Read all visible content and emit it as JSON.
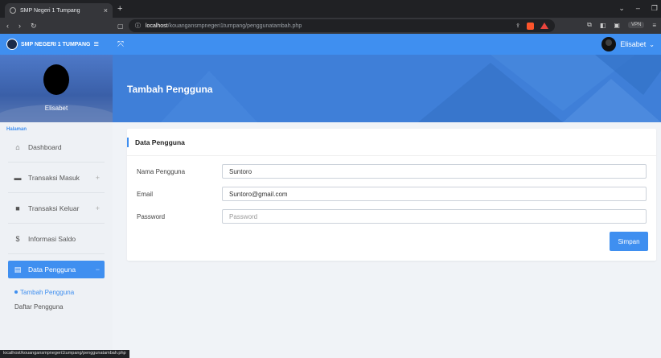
{
  "browser": {
    "tab_title": "SMP Negeri 1 Tumpang",
    "tab_close": "×",
    "new_tab": "+",
    "url_host": "localhost",
    "url_path": "/kouangansmpnegeri1tumpang/penggunatambah.php",
    "vpn_label": "VPN",
    "status_url": "localhost/kouangansmpnegeri1tumpang/penggunatambah.php"
  },
  "app": {
    "brand_name": "SMP NEGERI 1 TUMPANG",
    "user_name": "Elisabet",
    "accent_color": "#3f8ff0"
  },
  "sidebar": {
    "profile_name": "Elisabet",
    "heading": "Halaman",
    "items": [
      {
        "label": "Dashboard",
        "icon": "home-icon"
      },
      {
        "label": "Transaksi Masuk",
        "icon": "cash-icon",
        "plus": "+"
      },
      {
        "label": "Transaksi Keluar",
        "icon": "wallet-icon",
        "plus": "+"
      },
      {
        "label": "Informasi Saldo",
        "icon": "dollar-icon"
      },
      {
        "label": "Data Pengguna",
        "icon": "id-card-icon",
        "plus": "−"
      }
    ],
    "sub_items": [
      {
        "label": "Tambah Pengguna"
      },
      {
        "label": "Daftar Pengguna"
      }
    ]
  },
  "page": {
    "title": "Tambah Pengguna"
  },
  "form": {
    "header": "Data Pengguna",
    "fields": [
      {
        "label": "Nama Pengguna",
        "value": "Suntoro",
        "placeholder": ""
      },
      {
        "label": "Email",
        "value": "Suntoro@gmail.com",
        "placeholder": ""
      },
      {
        "label": "Password",
        "value": "",
        "placeholder": "Password"
      }
    ],
    "submit_label": "Simpan"
  }
}
